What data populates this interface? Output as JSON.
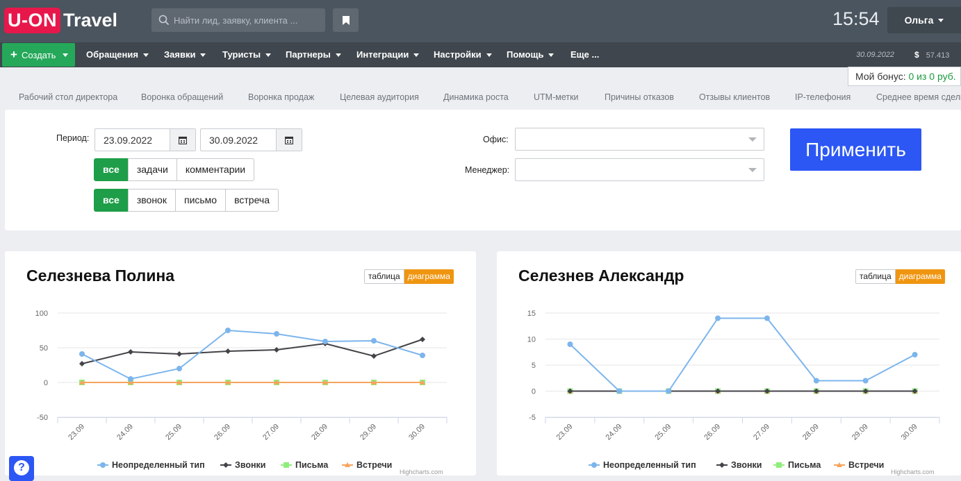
{
  "header": {
    "logo_mark": "U-ON",
    "logo_word": "Travel",
    "search_placeholder": "Найти лид, заявку, клиента ...",
    "clock": "15:54",
    "user": "Ольга"
  },
  "nav": {
    "create": "Создать",
    "items": [
      "Обращения",
      "Заявки",
      "Туристы",
      "Партнеры",
      "Интеграции",
      "Настройки",
      "Помощь",
      "Еще ..."
    ],
    "date": "30.09.2022",
    "currency_icon": "$",
    "balance": "57.413"
  },
  "bonus": {
    "label": "Мой бонус:",
    "value": "0 из 0 руб."
  },
  "tabs": [
    "Рабочий стол директора",
    "Воронка обращений",
    "Воронка продаж",
    "Целевая аудитория",
    "Динамика роста",
    "UTM-метки",
    "Причины отказов",
    "Отзывы клиентов",
    "IP-телефония",
    "Среднее время сделк"
  ],
  "filters": {
    "period_label": "Период:",
    "date_from": "23.09.2022",
    "date_to": "30.09.2022",
    "group1": [
      "все",
      "задачи",
      "комментарии"
    ],
    "group2": [
      "все",
      "звонок",
      "письмо",
      "встреча"
    ],
    "office_label": "Офис:",
    "manager_label": "Менеджер:",
    "apply": "Применить"
  },
  "toggle": {
    "table": "таблица",
    "chart": "диаграмма"
  },
  "legend": [
    "Неопределенный тип",
    "Звонки",
    "Письма",
    "Встречи"
  ],
  "credit": "Highcharts.com",
  "colors": {
    "undefined": "#7cb5ec",
    "calls": "#434348",
    "letters": "#90ed7d",
    "meetings": "#f7a35c"
  },
  "chart_data": [
    {
      "type": "line",
      "title": "Селезнева Полина",
      "categories": [
        "23.09",
        "24.09",
        "25.09",
        "26.09",
        "27.09",
        "28.09",
        "29.09",
        "30.09"
      ],
      "yticks": [
        100,
        50,
        0,
        -50
      ],
      "ylim": [
        -50,
        100
      ],
      "series": [
        {
          "name": "Неопределенный тип",
          "values": [
            41,
            5,
            20,
            75,
            70,
            59,
            60,
            39
          ]
        },
        {
          "name": "Звонки",
          "values": [
            27,
            44,
            41,
            45,
            47,
            56,
            38,
            62
          ]
        },
        {
          "name": "Письма",
          "values": [
            0,
            0,
            0,
            0,
            0,
            0,
            0,
            0
          ]
        },
        {
          "name": "Встречи",
          "values": [
            0,
            0,
            0,
            0,
            0,
            0,
            0,
            0
          ]
        }
      ]
    },
    {
      "type": "line",
      "title": "Селезнев Александр",
      "categories": [
        "23.09",
        "24.09",
        "25.09",
        "26.09",
        "27.09",
        "28.09",
        "29.09",
        "30.09"
      ],
      "yticks": [
        15,
        10,
        5,
        0,
        -5
      ],
      "ylim": [
        -5,
        15
      ],
      "series": [
        {
          "name": "Неопределенный тип",
          "values": [
            9,
            0,
            0,
            14,
            14,
            2,
            2,
            7
          ]
        },
        {
          "name": "Звонки",
          "values": [
            0,
            0,
            0,
            0,
            0,
            0,
            0,
            0
          ]
        },
        {
          "name": "Письма",
          "values": [
            0,
            0,
            0,
            0,
            0,
            0,
            0,
            0
          ]
        },
        {
          "name": "Встречи",
          "values": [
            0,
            0,
            0,
            0,
            0,
            0,
            0,
            0
          ]
        }
      ]
    }
  ]
}
